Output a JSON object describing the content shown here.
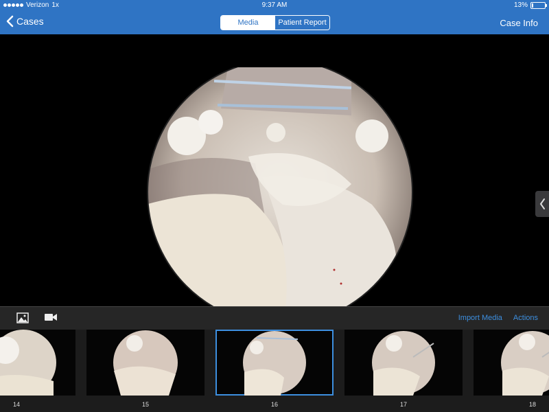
{
  "status_bar": {
    "carrier": "Verizon",
    "network": "1x",
    "time": "9:37 AM",
    "battery_percent": "13%",
    "battery_level": 0.13
  },
  "nav": {
    "back_label": "Cases",
    "segments": [
      {
        "label": "Media",
        "active": true
      },
      {
        "label": "Patient Report",
        "active": false
      }
    ],
    "right_label": "Case Info"
  },
  "toolbar": {
    "photo_icon": "photo-icon",
    "video_icon": "video-camera-icon",
    "import_label": "Import Media",
    "actions_label": "Actions"
  },
  "thumbnails": [
    {
      "label": "14",
      "selected": false
    },
    {
      "label": "15",
      "selected": false
    },
    {
      "label": "16",
      "selected": true
    },
    {
      "label": "17",
      "selected": false
    },
    {
      "label": "18",
      "selected": false
    }
  ],
  "colors": {
    "nav_blue": "#2f74c4",
    "accent_blue": "#3d8fe0"
  }
}
